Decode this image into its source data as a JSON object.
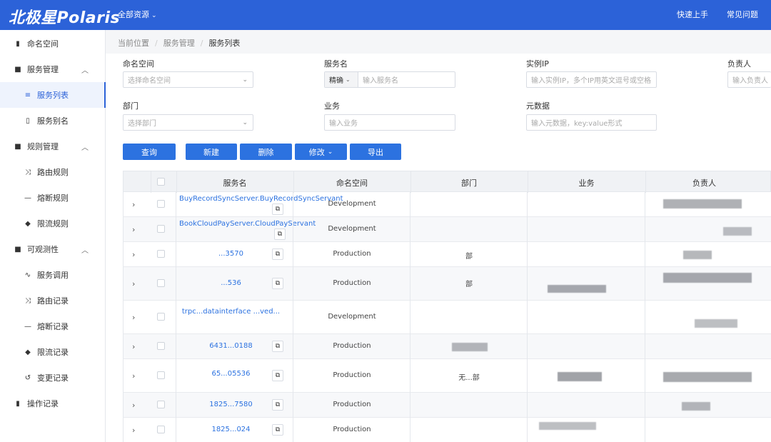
{
  "header": {
    "logo": "北极星Polaris",
    "resource_menu": "全部资源",
    "quick_start": "快速上手",
    "faq": "常见问题"
  },
  "sidebar": {
    "items": [
      {
        "label": "命名空间",
        "icon": "bookmark-icon"
      },
      {
        "label": "服务管理",
        "icon": "folder-icon",
        "expanded": true
      },
      {
        "label": "服务列表",
        "icon": "list-icon",
        "active": true
      },
      {
        "label": "服务别名",
        "icon": "file-icon"
      },
      {
        "label": "规则管理",
        "icon": "folder-icon",
        "expanded": true
      },
      {
        "label": "路由规则",
        "icon": "route-icon"
      },
      {
        "label": "熔断规则",
        "icon": "dash-icon"
      },
      {
        "label": "限流规则",
        "icon": "cube-icon"
      },
      {
        "label": "可观测性",
        "icon": "folder-icon",
        "expanded": true
      },
      {
        "label": "服务调用",
        "icon": "pulse-icon"
      },
      {
        "label": "路由记录",
        "icon": "route-icon"
      },
      {
        "label": "熔断记录",
        "icon": "dash-icon"
      },
      {
        "label": "限流记录",
        "icon": "cube-icon"
      },
      {
        "label": "变更记录",
        "icon": "history-icon"
      },
      {
        "label": "操作记录",
        "icon": "doc-icon"
      }
    ]
  },
  "breadcrumb": {
    "root": "当前位置",
    "parent": "服务管理",
    "current": "服务列表"
  },
  "filters": {
    "namespace_label": "命名空间",
    "namespace_placeholder": "选择命名空间",
    "service_label": "服务名",
    "service_mode": "精确",
    "service_placeholder": "输入服务名",
    "ip_label": "实例IP",
    "ip_placeholder": "输入实例IP，多个IP用英文逗号或空格",
    "owner_label": "负责人",
    "owner_placeholder": "输入负责人",
    "dept_label": "部门",
    "dept_placeholder": "选择部门",
    "business_label": "业务",
    "business_placeholder": "输入业务",
    "meta_label": "元数据",
    "meta_placeholder": "输入元数据，key:value形式"
  },
  "actions": {
    "query": "查询",
    "create": "新建",
    "delete": "删除",
    "modify": "修改",
    "export": "导出"
  },
  "table": {
    "columns": [
      "服务名",
      "命名空间",
      "部门",
      "业务",
      "负责人"
    ],
    "rows": [
      {
        "name": "BuyRecordSyncServer.BuyRecordSyncServant",
        "namespace": "Development",
        "dept": "",
        "business": ""
      },
      {
        "name": "BookCloudPayServer.CloudPayServant",
        "namespace": "Development",
        "dept": "",
        "business": ""
      },
      {
        "name": "...3570",
        "namespace": "Production",
        "dept": "部",
        "business": ""
      },
      {
        "name": "...536",
        "namespace": "Production",
        "dept": "部",
        "business": ""
      },
      {
        "name": "trpc...datainterface ...ved...",
        "namespace": "Development",
        "dept": "",
        "business": ""
      },
      {
        "name": "6431...0188",
        "namespace": "Production",
        "dept": "",
        "business": ""
      },
      {
        "name": "65...05536",
        "namespace": "Production",
        "dept": "无...部",
        "business": ""
      },
      {
        "name": "1825...7580",
        "namespace": "Production",
        "dept": "",
        "business": ""
      },
      {
        "name": "1825...024",
        "namespace": "Production",
        "dept": "",
        "business": ""
      }
    ]
  }
}
